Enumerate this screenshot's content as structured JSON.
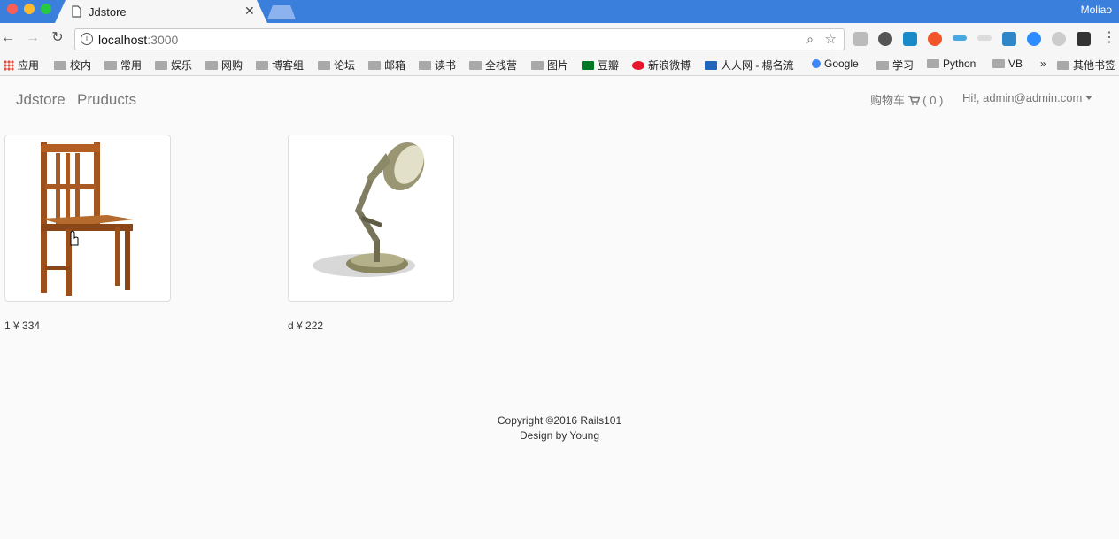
{
  "browser": {
    "tab_title": "Jdstore",
    "tab_close": "✕",
    "user_name": "Moliao",
    "url_host": "localhost",
    "url_port": ":3000",
    "bookmarks": [
      "应用",
      "校内",
      "常用",
      "娱乐",
      "网购",
      "博客组",
      "论坛",
      "邮箱",
      "读书",
      "全栈营",
      "图片",
      "豆瓣",
      "新浪微博",
      "人人网 - 楊名流",
      "Google",
      "学习",
      "Python",
      "VB",
      "»",
      "其他书签"
    ]
  },
  "navbar": {
    "brand": "Jdstore",
    "products_link": "Pruducts",
    "cart_label": "购物车",
    "cart_count": "( 0 )",
    "account_label": "Hi!, admin@admin.com"
  },
  "products": [
    {
      "name": "1",
      "price": "¥ 334",
      "image": "wooden-chair"
    },
    {
      "name": "d",
      "price": "¥ 222",
      "image": "desk-lamp"
    }
  ],
  "footer": {
    "copyright": "Copyright ©2016 Rails101",
    "design": "Design by Young"
  },
  "colors": {
    "tabbar": "#3b7fdc",
    "nav_text": "#777777"
  }
}
